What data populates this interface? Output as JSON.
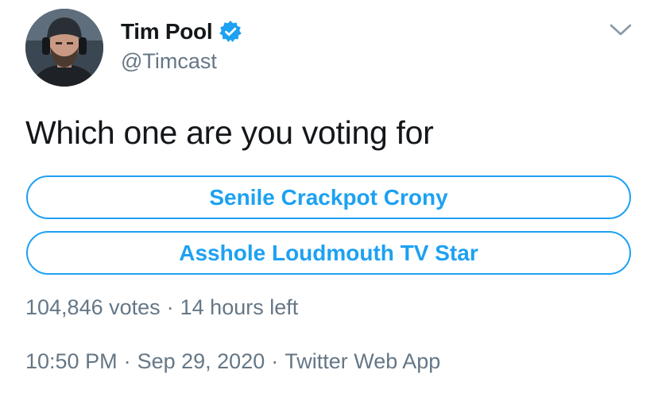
{
  "tweet": {
    "author": {
      "name": "Tim Pool",
      "handle": "@Timcast",
      "verified": true
    },
    "text": "Which one are you voting for",
    "poll": {
      "options": [
        {
          "label": "Senile Crackpot Crony"
        },
        {
          "label": "Asshole Loudmouth TV Star"
        }
      ],
      "votes": "104,846 votes",
      "time_left": "14 hours left"
    },
    "timestamp": {
      "time": "10:50 PM",
      "date": "Sep 29, 2020",
      "source": "Twitter Web App"
    }
  },
  "icons": {
    "verified": "verified-badge-icon",
    "menu": "chevron-down-icon"
  },
  "colors": {
    "accent": "#1da1f2",
    "text": "#14171a",
    "secondary": "#657786"
  }
}
